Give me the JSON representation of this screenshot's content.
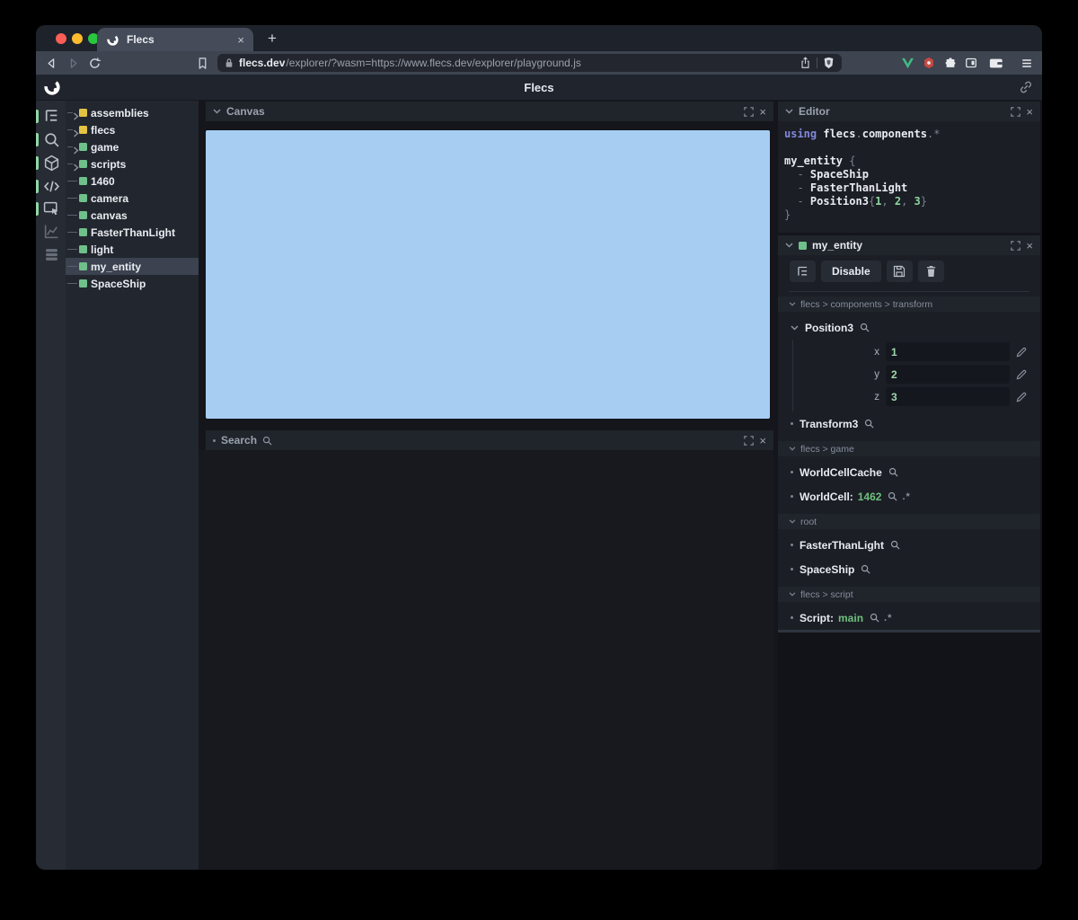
{
  "browser": {
    "tab": {
      "title": "Flecs",
      "close_label": "×",
      "new_tab_label": "+"
    },
    "url": {
      "domain": "flecs.dev",
      "path": "/explorer/?wasm=https://www.flecs.dev/explorer/playground.js"
    }
  },
  "app_header": {
    "title": "Flecs"
  },
  "activity_bar": {
    "items": [
      {
        "id": "tree",
        "icon": "tree-icon",
        "active": true
      },
      {
        "id": "search",
        "icon": "search-icon",
        "active": true
      },
      {
        "id": "entities",
        "icon": "cube-icon",
        "active": true
      },
      {
        "id": "code",
        "icon": "code-icon",
        "active": true
      },
      {
        "id": "canvas",
        "icon": "canvas-icon",
        "active": true
      },
      {
        "id": "stats",
        "icon": "chart-icon",
        "active": false
      },
      {
        "id": "tables",
        "icon": "rows-icon",
        "active": false
      }
    ]
  },
  "tree": {
    "items": [
      {
        "label": "assemblies",
        "square_color": "#e3c343",
        "expandable": true,
        "selected": false
      },
      {
        "label": "flecs",
        "square_color": "#e3c343",
        "expandable": true,
        "selected": false
      },
      {
        "label": "game",
        "square_color": "#6fc08a",
        "expandable": true,
        "selected": false
      },
      {
        "label": "scripts",
        "square_color": "#6fc08a",
        "expandable": true,
        "selected": false
      },
      {
        "label": "1460",
        "square_color": "#6fc08a",
        "expandable": false,
        "selected": false
      },
      {
        "label": "camera",
        "square_color": "#6fc08a",
        "expandable": false,
        "selected": false
      },
      {
        "label": "canvas",
        "square_color": "#6fc08a",
        "expandable": false,
        "selected": false
      },
      {
        "label": "FasterThanLight",
        "square_color": "#6fc08a",
        "expandable": false,
        "selected": false
      },
      {
        "label": "light",
        "square_color": "#6fc08a",
        "expandable": false,
        "selected": false
      },
      {
        "label": "my_entity",
        "square_color": "#6fc08a",
        "expandable": false,
        "selected": true
      },
      {
        "label": "SpaceShip",
        "square_color": "#6fc08a",
        "expandable": false,
        "selected": false
      }
    ]
  },
  "panels": {
    "canvas": {
      "title": "Canvas",
      "viewport_color": "#a7cdf2"
    },
    "search": {
      "title": "Search"
    },
    "editor": {
      "title": "Editor",
      "code": [
        [
          {
            "t": "using ",
            "c": "kw"
          },
          {
            "t": "flecs",
            "c": "id"
          },
          {
            "t": ".",
            "c": "p"
          },
          {
            "t": "components",
            "c": "id"
          },
          {
            "t": ".*",
            "c": "p"
          }
        ],
        [],
        [
          {
            "t": "my_entity ",
            "c": "id"
          },
          {
            "t": "{",
            "c": "p"
          }
        ],
        [
          {
            "t": "  - ",
            "c": "p"
          },
          {
            "t": "SpaceShip",
            "c": "id"
          }
        ],
        [
          {
            "t": "  - ",
            "c": "p"
          },
          {
            "t": "FasterThanLight",
            "c": "id"
          }
        ],
        [
          {
            "t": "  - ",
            "c": "p"
          },
          {
            "t": "Position3",
            "c": "id"
          },
          {
            "t": "{",
            "c": "p"
          },
          {
            "t": "1",
            "c": "num"
          },
          {
            "t": ", ",
            "c": "p"
          },
          {
            "t": "2",
            "c": "num"
          },
          {
            "t": ", ",
            "c": "p"
          },
          {
            "t": "3",
            "c": "num"
          },
          {
            "t": "}",
            "c": "p"
          }
        ],
        [
          {
            "t": "}",
            "c": "p"
          }
        ]
      ]
    },
    "inspector": {
      "title": "my_entity",
      "toolbar": {
        "disable_label": "Disable"
      },
      "sections": [
        {
          "path": "flecs > components > transform",
          "items": [
            {
              "kind": "expanded",
              "name": "Position3",
              "fields": [
                {
                  "label": "x",
                  "value": "1"
                },
                {
                  "label": "y",
                  "value": "2"
                },
                {
                  "label": "z",
                  "value": "3"
                }
              ]
            },
            {
              "kind": "component",
              "name": "Transform3"
            }
          ]
        },
        {
          "path": "flecs > game",
          "items": [
            {
              "kind": "component",
              "name": "WorldCellCache"
            },
            {
              "kind": "component",
              "name": "WorldCell:",
              "value": "1462",
              "pair": true
            }
          ]
        },
        {
          "path": "root",
          "items": [
            {
              "kind": "component",
              "name": "FasterThanLight"
            },
            {
              "kind": "component",
              "name": "SpaceShip"
            }
          ]
        },
        {
          "path": "flecs > script",
          "items": [
            {
              "kind": "component",
              "name": "Script:",
              "value": "main",
              "pair": true
            }
          ]
        }
      ]
    }
  },
  "colors": {
    "accent_green": "#6fc08a",
    "accent_yellow": "#e3c343",
    "canvas_blue": "#a7cdf2",
    "value_green": "#9fd8ab",
    "traffic_red": "#f95f57",
    "traffic_yellow": "#fdbb2e",
    "traffic_green": "#29c73f"
  }
}
